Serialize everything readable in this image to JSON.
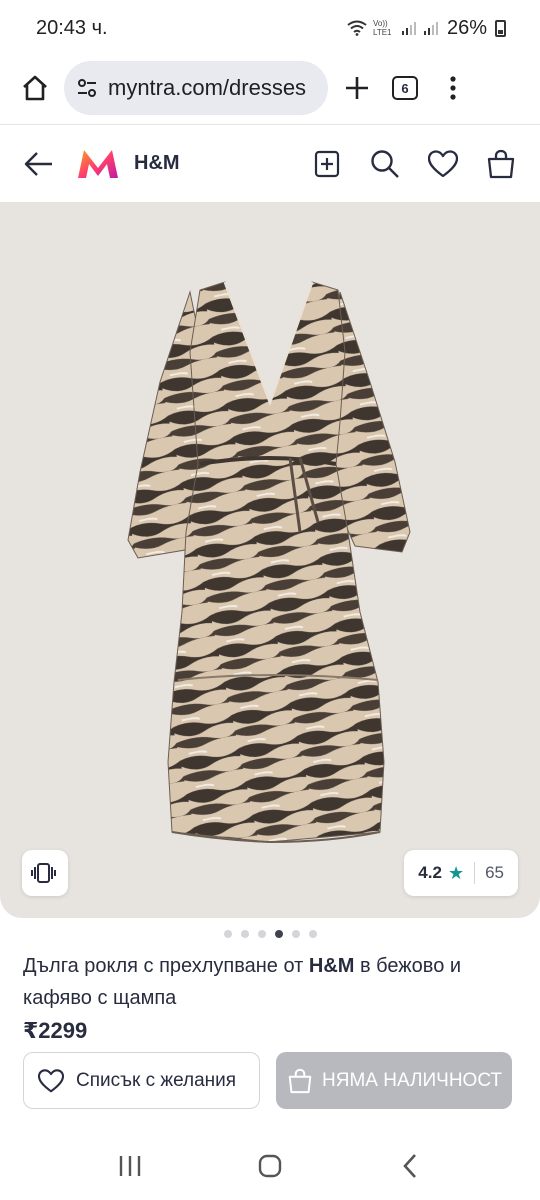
{
  "status_bar": {
    "time": "20:43 ч.",
    "network_label": "Vo)) LTE1",
    "battery": "26%"
  },
  "browser": {
    "url": "myntra.com/dresses",
    "tab_count": "6"
  },
  "header": {
    "brand": "H&M"
  },
  "product": {
    "rating": "4.2",
    "rating_count": "65",
    "image_count": 6,
    "active_image_index": 3,
    "title_prefix": "Дълга рокля с прехлупване от ",
    "title_brand": "H&M",
    "title_suffix": " в бежово и кафяво с щампа",
    "price": "₹2299"
  },
  "actions": {
    "wishlist_label": "Списък с желания",
    "out_of_stock_label": "НЯМА НАЛИЧНОСТ"
  },
  "colors": {
    "brand_pink": "#ff3f6c",
    "brand_orange": "#f7a01d",
    "rating_star": "#14958f",
    "disabled_button": "#b8b9bf",
    "image_background": "#e7e4e0"
  }
}
